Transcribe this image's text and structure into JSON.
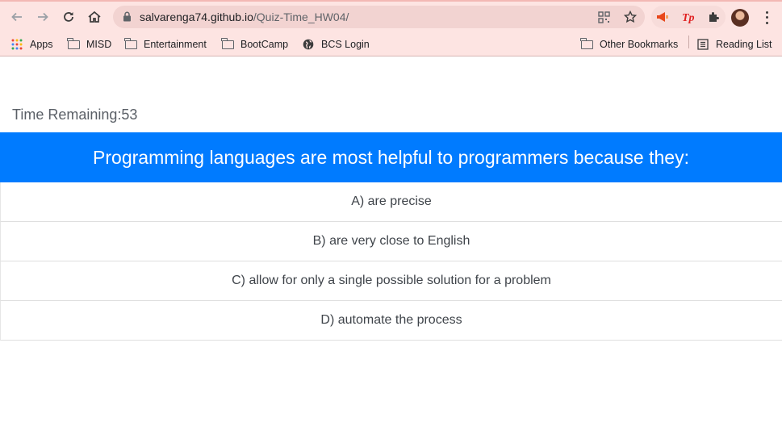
{
  "browser": {
    "url_host": "salvarenga74.github.io",
    "url_path": "/Quiz-Time_HW04/",
    "bookmarks": [
      {
        "label": "Apps",
        "icon": "apps-grid-icon"
      },
      {
        "label": "MISD",
        "icon": "folder-icon"
      },
      {
        "label": "Entertainment",
        "icon": "folder-icon"
      },
      {
        "label": "BootCamp",
        "icon": "folder-icon"
      },
      {
        "label": "BCS Login",
        "icon": "globe-icon"
      }
    ],
    "other_bookmarks": "Other Bookmarks",
    "reading_list": "Reading List",
    "colors": {
      "chrome_bg": "#fde4e2",
      "omnibox_bg": "#f2d3d1"
    }
  },
  "quiz": {
    "timer_label": "Time Remaining:53",
    "question": "Programming languages are most helpful to programmers because they:",
    "answers": [
      "A) are precise",
      "B) are very close to English",
      "C) allow for only a single possible solution for a problem",
      "D) automate the process"
    ],
    "colors": {
      "question_bg": "#007bff",
      "question_text": "#ffffff"
    }
  }
}
